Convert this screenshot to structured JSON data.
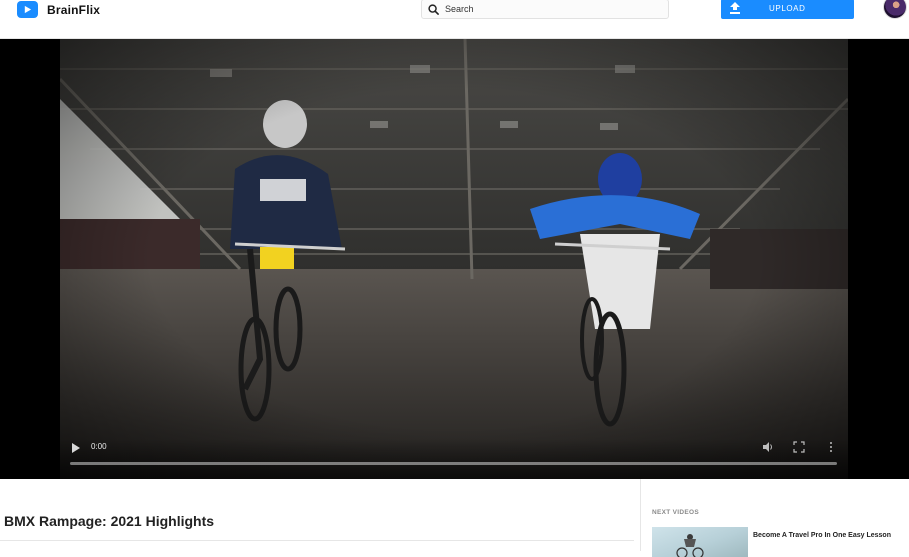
{
  "app": {
    "name": "BrainFlix"
  },
  "header": {
    "search_placeholder": "Search",
    "upload_label": "UPLOAD"
  },
  "player": {
    "current_time": "0:00",
    "progress": 0
  },
  "video": {
    "title": "BMX Rampage: 2021 Highlights"
  },
  "sidebar": {
    "heading": "NEXT VIDEOS",
    "items": [
      {
        "title": "Become A Travel Pro In One Easy Lesson"
      }
    ]
  },
  "colors": {
    "accent": "#1a8cff",
    "title_text": "#222222",
    "muted_text": "#8a8a8a"
  }
}
